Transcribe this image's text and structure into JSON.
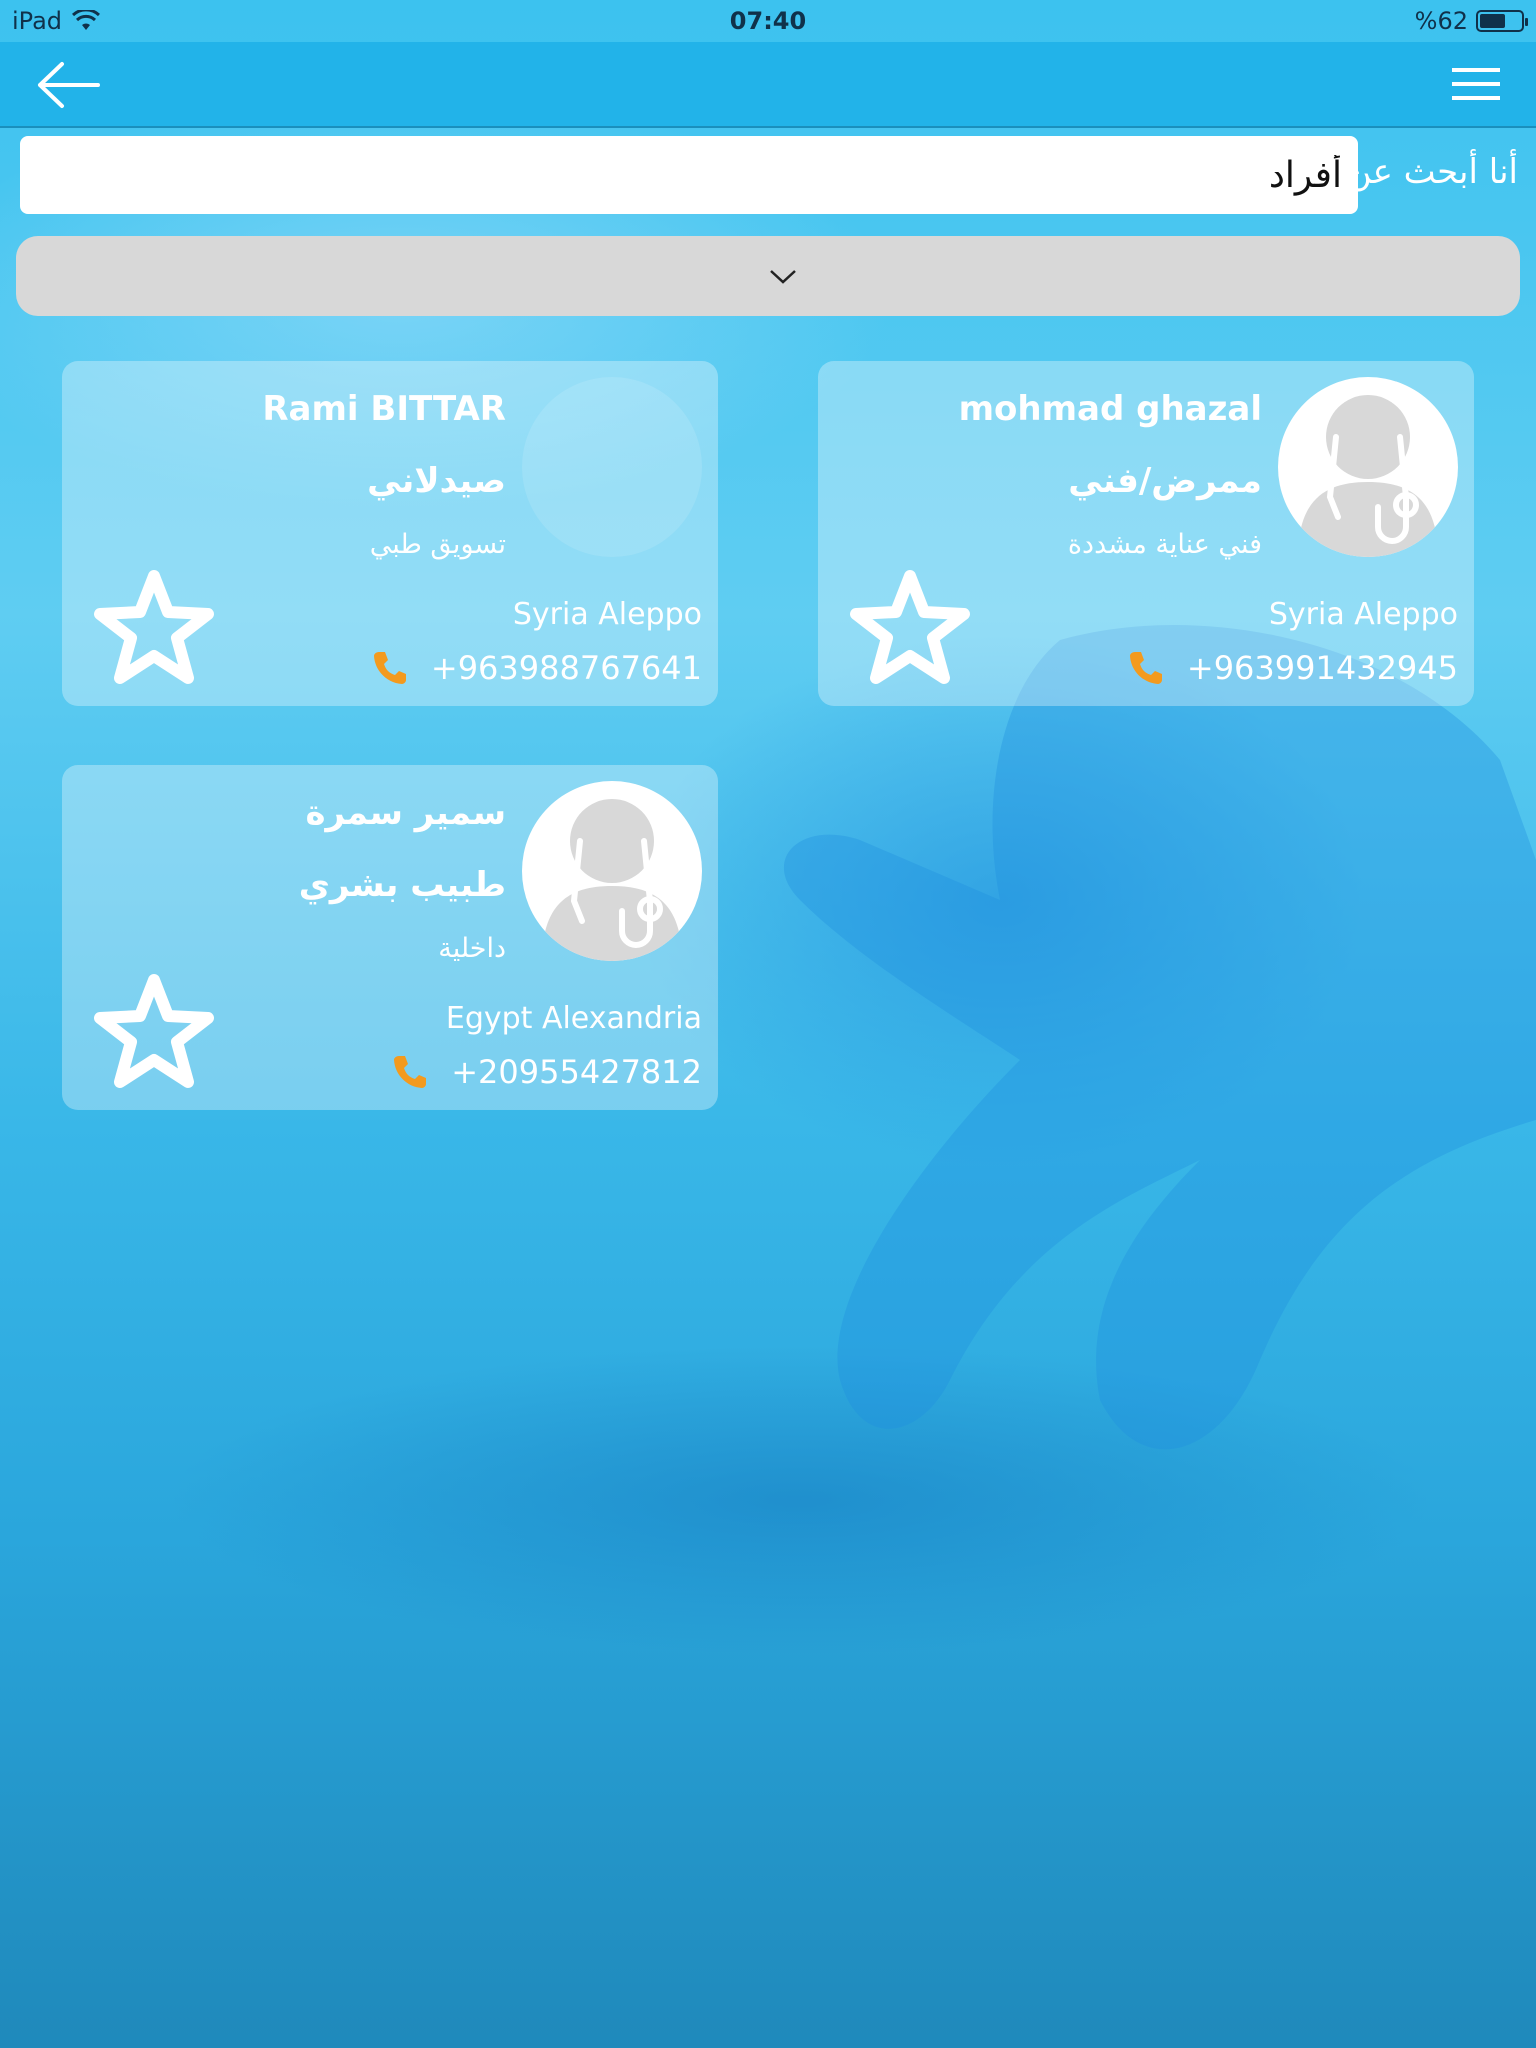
{
  "status_bar": {
    "device": "iPad",
    "time": "07:40",
    "battery": "%62",
    "battery_level": 0.62
  },
  "search": {
    "label": "أنا أبحث عن:",
    "value": "أفراد"
  },
  "colors": {
    "navbar": "#22b3e9",
    "accent_phone": "#f39a1e",
    "card_text": "#ffffff",
    "dropdown_bg": "#d8d8d8"
  },
  "cards": [
    {
      "name": "mohmad ghazal",
      "role": "ممرض/فني",
      "specialty": "فني عناية مشددة",
      "location": "Syria Aleppo",
      "phone": "+963991432945",
      "avatar": "doctor-avatar-icon"
    },
    {
      "name": "Rami BITTAR",
      "role": "صيدلاني",
      "specialty": "تسويق طبي",
      "location": "Syria Aleppo",
      "phone": "+963988767641",
      "avatar": "empty-avatar"
    },
    {
      "name": "سمير سمرة",
      "role": "طبيب بشري",
      "specialty": "داخلية",
      "location": "Egypt Alexandria",
      "phone": "+20955427812",
      "avatar": "doctor-avatar-icon"
    }
  ]
}
